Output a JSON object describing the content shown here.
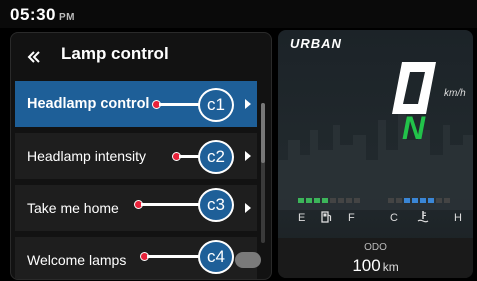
{
  "status": {
    "time": "05:30",
    "ampm": "PM"
  },
  "menu": {
    "title": "Lamp control",
    "items": [
      {
        "label": "Headlamp control",
        "selected": true,
        "control": "arrow"
      },
      {
        "label": "Headlamp intensity",
        "selected": false,
        "control": "arrow"
      },
      {
        "label": "Take me home",
        "selected": false,
        "control": "arrow"
      },
      {
        "label": "Welcome lamps",
        "selected": false,
        "control": "toggle",
        "toggle_on": false
      }
    ]
  },
  "callouts": [
    {
      "label": "c1"
    },
    {
      "label": "c2"
    },
    {
      "label": "c3"
    },
    {
      "label": "c4"
    }
  ],
  "cluster": {
    "brand": "URBAN",
    "speed_unit": "km/h",
    "gear": "N",
    "fuel": {
      "empty_label": "E",
      "full_label": "F",
      "level_fraction": 0.5,
      "icon": "fuel-pump-icon"
    },
    "temperature": {
      "cold_label": "C",
      "hot_label": "H",
      "level_fraction": 0.5,
      "icon": "coolant-temperature-icon"
    },
    "odo": {
      "label": "ODO",
      "value": "100",
      "unit": "km"
    }
  },
  "colors": {
    "selected_item": "#1e5f98",
    "callout_dot": "#e8223a",
    "gear": "#22c24a",
    "fuel_segment": "#3cb55a",
    "temp_segment": "#3a86d6"
  }
}
